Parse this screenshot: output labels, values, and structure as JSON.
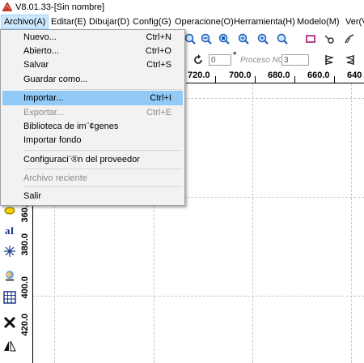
{
  "window": {
    "title": "V8.01.33-[Sin nombre]"
  },
  "menubar": [
    {
      "label": "Archivo(A)"
    },
    {
      "label": "Editar(E)"
    },
    {
      "label": "Dibujar(D)"
    },
    {
      "label": "Config(G)"
    },
    {
      "label": "Operacione(O)"
    },
    {
      "label": "Herramienta(H)"
    },
    {
      "label": "Modelo(M)"
    },
    {
      "label": "Ver(V)"
    }
  ],
  "file_menu": {
    "items": [
      {
        "label": "Nuevo...",
        "shortcut": "Ctrl+N",
        "enabled": true
      },
      {
        "label": "Abierto...",
        "shortcut": "Ctrl+O",
        "enabled": true
      },
      {
        "label": "Salvar",
        "shortcut": "Ctrl+S",
        "enabled": true
      },
      {
        "label": "Guardar como...",
        "shortcut": "",
        "enabled": true
      },
      {
        "label": "Importar...",
        "shortcut": "Ctrl+I",
        "enabled": true,
        "highlighted": true
      },
      {
        "label": "Exportar...",
        "shortcut": "Ctrl+E",
        "enabled": false
      },
      {
        "label": "Biblioteca de im¨¢genes",
        "shortcut": "",
        "enabled": true
      },
      {
        "label": "Importar fondo",
        "shortcut": "",
        "enabled": true
      },
      {
        "label": "Configuraci¨®n del proveedor",
        "shortcut": "",
        "enabled": true
      },
      {
        "label": "Archivo reciente",
        "shortcut": "",
        "enabled": false
      },
      {
        "label": "Salir",
        "shortcut": "",
        "enabled": true
      }
    ]
  },
  "toolbar2": {
    "angle_value": "0",
    "degree_symbol": "°",
    "process_label": "Proceso NO:",
    "process_value": "3"
  },
  "ruler_top": {
    "labels": [
      "720.0",
      "700.0",
      "680.0",
      "660.0",
      "640"
    ]
  },
  "ruler_left": {
    "labels": [
      "360.0",
      "380.0",
      "400.0",
      "420.0"
    ]
  },
  "colors": {
    "highlight": "#91c9f7",
    "menu_active": "#cce8ff",
    "menu_bg": "#f2f2f2",
    "disabled": "#8a8a8a"
  }
}
